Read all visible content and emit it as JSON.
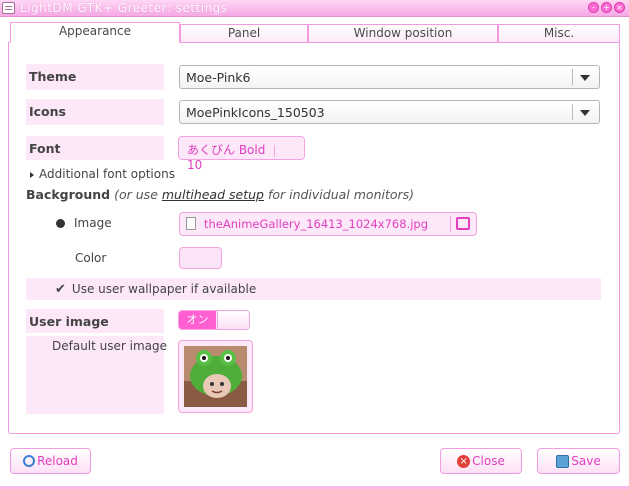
{
  "window": {
    "title": "LightDM GTK+ Greeter: settings"
  },
  "tabs": [
    {
      "label": "Appearance"
    },
    {
      "label": "Panel"
    },
    {
      "label": "Window position"
    },
    {
      "label": "Misc."
    }
  ],
  "theme": {
    "label": "Theme",
    "value": "Moe-Pink6"
  },
  "icons": {
    "label": "Icons",
    "value": "MoePinkIcons_150503"
  },
  "font": {
    "label": "Font",
    "name": "あくびん Bold",
    "size": "10"
  },
  "additional_font": {
    "label": "Additional font options"
  },
  "background": {
    "label": "Background",
    "note_prefix": "(or use ",
    "note_link": "multihead setup",
    "note_suffix": " for individual monitors)",
    "image_label": "Image",
    "image_file": "theAnimeGallery_16413_1024x768.jpg",
    "color_label": "Color",
    "color_value": "#fce4f8"
  },
  "wallpaper": {
    "label": "Use user wallpaper if available",
    "checked": true
  },
  "user_image": {
    "label": "User image",
    "toggle_on_text": "オン",
    "enabled": true
  },
  "default_user_image": {
    "label": "Default user image"
  },
  "footer": {
    "reload": "Reload",
    "close": "Close",
    "save": "Save"
  },
  "colors": {
    "accent": "#e23fbf",
    "pink_light": "#fde8fa",
    "border": "#f39be0"
  }
}
